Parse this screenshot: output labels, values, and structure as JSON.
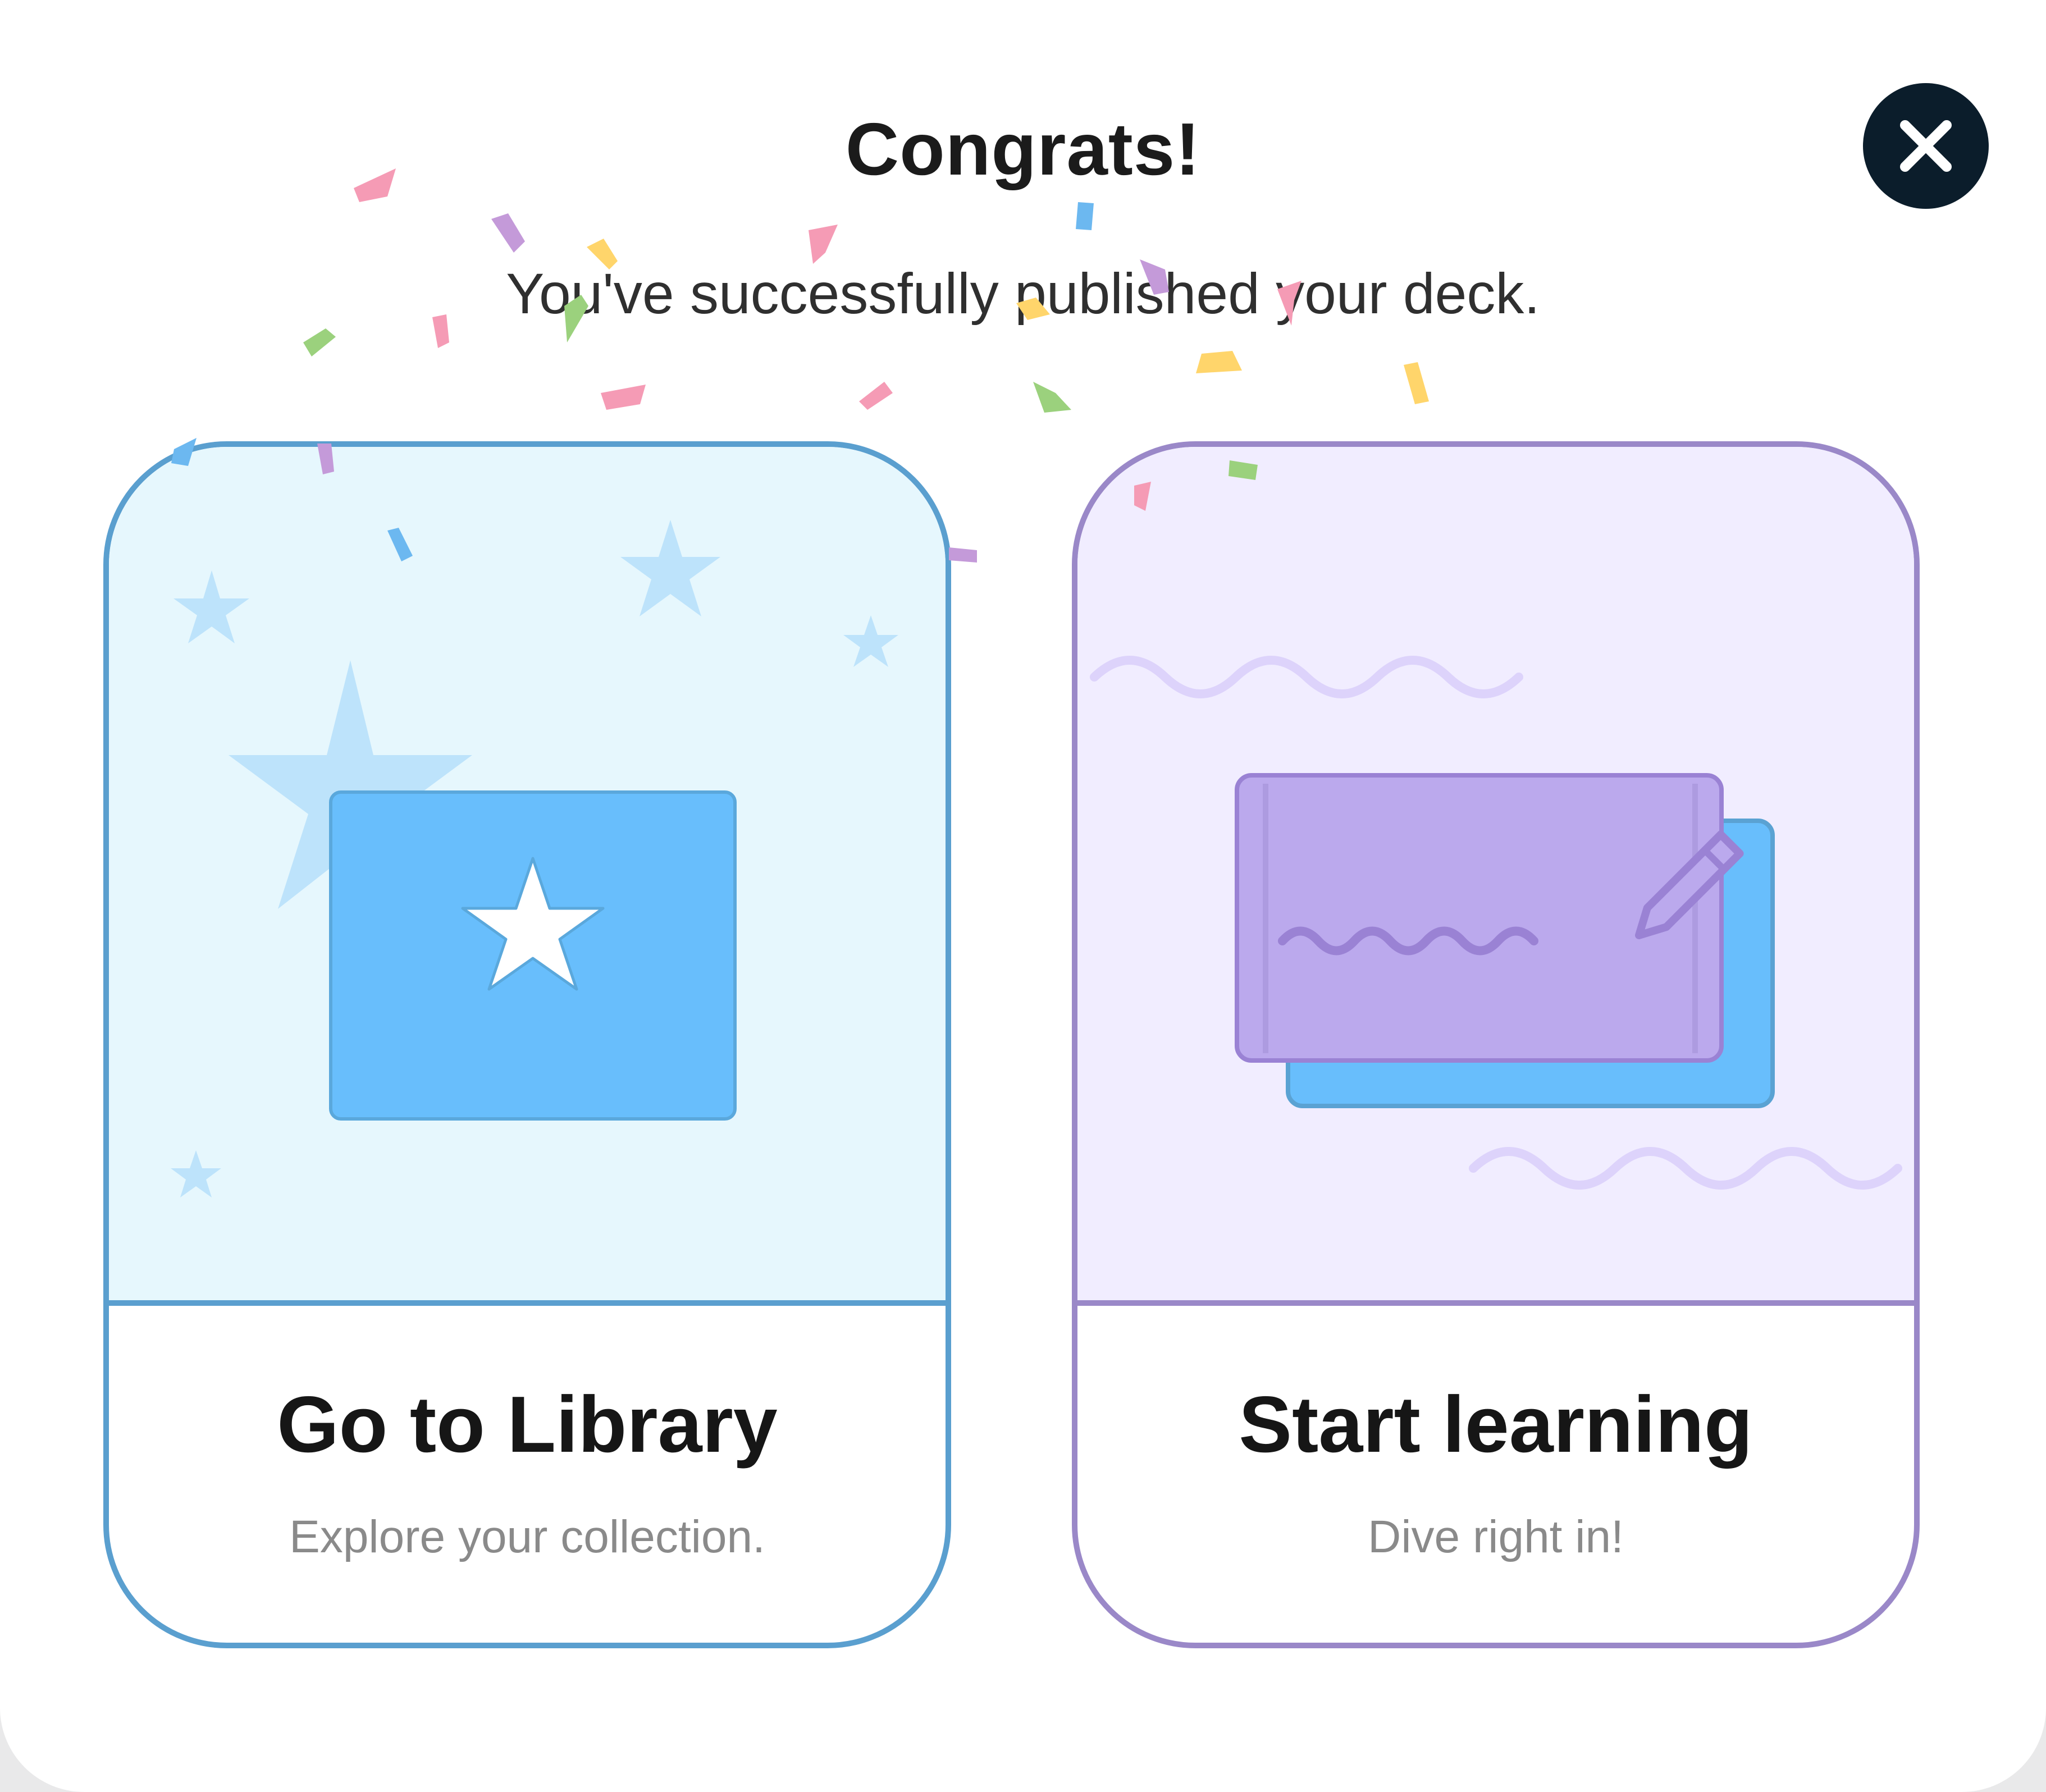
{
  "dialog": {
    "title": "Congrats!",
    "subtitle": "You've successfully published your deck.",
    "close_icon": "close-icon"
  },
  "cards": {
    "library": {
      "title": "Go to Library",
      "subtitle": "Explore your collection.",
      "icon": "star-folder-icon",
      "accent": "#5a9fcf",
      "background": "#e6f7fd"
    },
    "learn": {
      "title": "Start learning",
      "subtitle": "Dive right in!",
      "icon": "flashcards-pencil-icon",
      "accent": "#9a88c8",
      "background": "#f1edff"
    }
  },
  "colors": {
    "close_button": "#0b1d2b",
    "confetti": [
      "#f59bb5",
      "#c49ad9",
      "#ffd56b",
      "#9bd17d",
      "#6cb8f0"
    ]
  }
}
